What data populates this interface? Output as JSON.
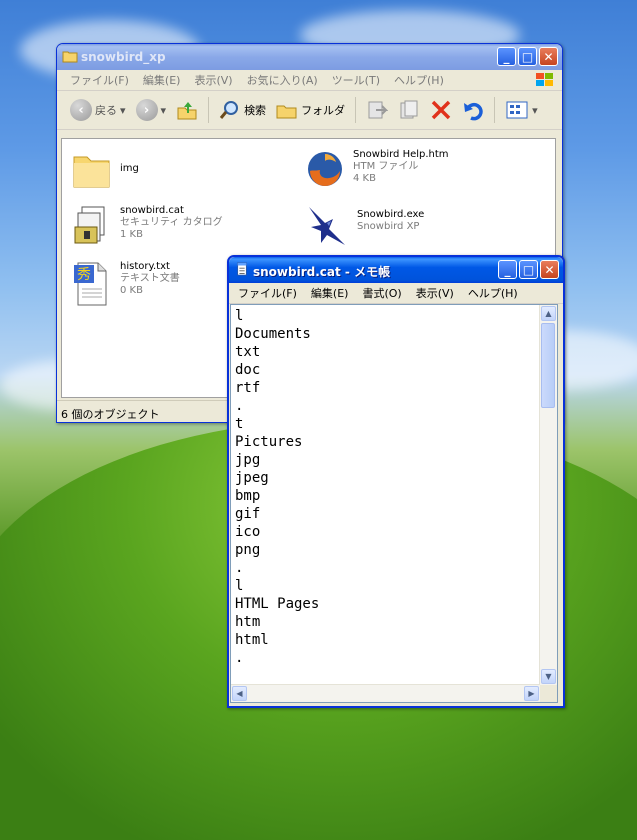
{
  "explorer": {
    "title": "snowbird_xp",
    "menu": [
      "ファイル(F)",
      "編集(E)",
      "表示(V)",
      "お気に入り(A)",
      "ツール(T)",
      "ヘルプ(H)"
    ],
    "toolbar": {
      "back": "戻る",
      "search": "検索",
      "folders": "フォルダ"
    },
    "files": [
      {
        "name": "img",
        "type": "",
        "size": "",
        "icon": "folder-icon"
      },
      {
        "name": "Snowbird Help.htm",
        "type": "HTM ファイル",
        "size": "4 KB",
        "icon": "firefox-icon"
      },
      {
        "name": "snowbird.cat",
        "type": "セキュリティ カタログ",
        "size": "1 KB",
        "icon": "security-catalog-icon"
      },
      {
        "name": "Snowbird.exe",
        "type": "Snowbird XP",
        "size": "",
        "icon": "snowbird-bird-icon"
      },
      {
        "name": "history.txt",
        "type": "テキスト文書",
        "size": "0 KB",
        "icon": "text-file-icon"
      }
    ],
    "status": "6 個のオブジェクト"
  },
  "notepad": {
    "title": "snowbird.cat - メモ帳",
    "menu": [
      "ファイル(F)",
      "編集(E)",
      "書式(O)",
      "表示(V)",
      "ヘルプ(H)"
    ],
    "lines": [
      "l",
      "Documents",
      "txt",
      "doc",
      "rtf",
      ".",
      "t",
      "Pictures",
      "jpg",
      "jpeg",
      "bmp",
      "gif",
      "ico",
      "png",
      ".",
      "l",
      "HTML Pages",
      "htm",
      "html",
      "."
    ]
  },
  "colors": {
    "title_blue": "#0058e6",
    "close_red": "#c6441f",
    "desktop_sky": "#5e9ae6",
    "desktop_grass": "#5aa51f"
  }
}
